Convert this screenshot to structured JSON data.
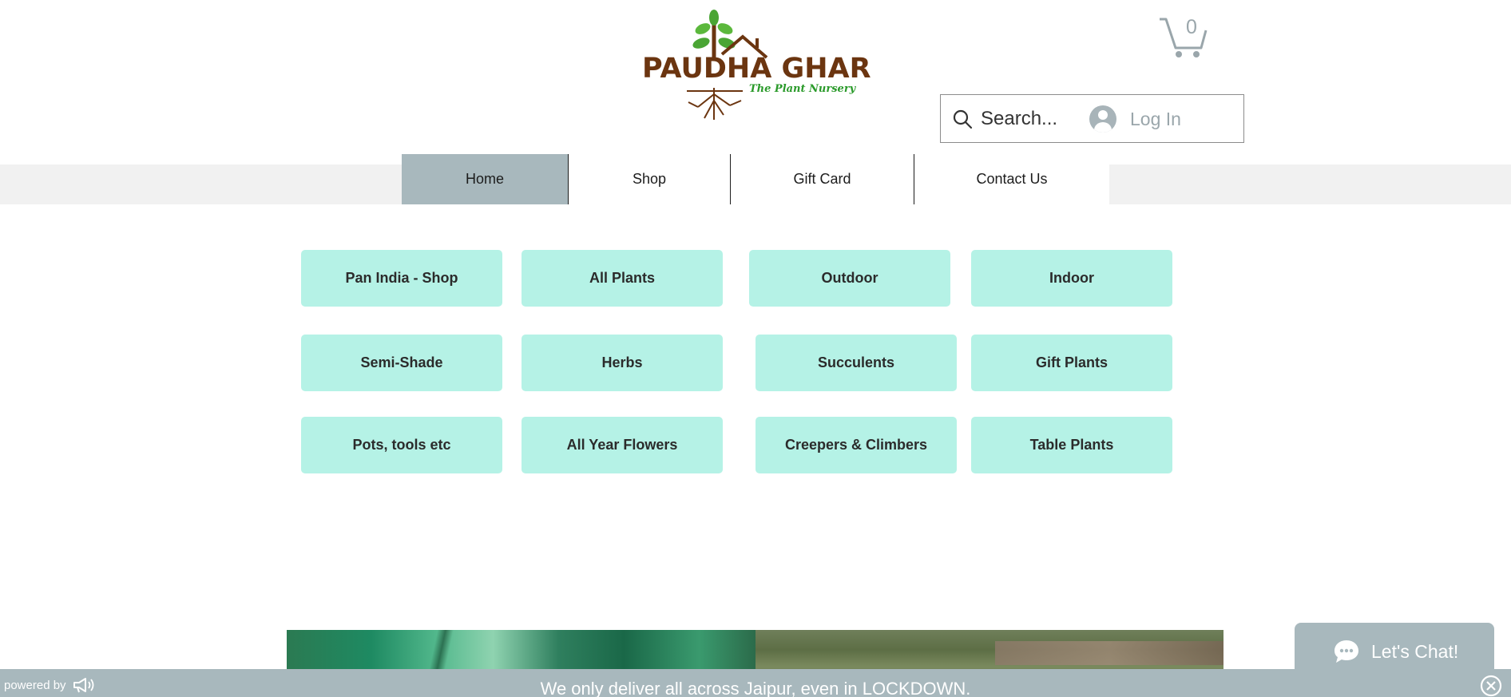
{
  "logo": {
    "brand": "PAUDHA GHAR",
    "tagline": "The Plant Nursery"
  },
  "cart": {
    "count": "0"
  },
  "search": {
    "placeholder": "Search..."
  },
  "login": {
    "label": "Log In"
  },
  "nav": {
    "items": [
      "Home",
      "Shop",
      "Gift Card",
      "Contact Us"
    ],
    "active": "Home"
  },
  "categories": [
    "Pan India - Shop",
    "All Plants",
    "Outdoor",
    "Indoor",
    "Semi-Shade",
    "Herbs",
    "Succulents",
    "Gift Plants",
    "Pots, tools etc",
    "All Year Flowers",
    "Creepers & Climbers",
    "Table Plants"
  ],
  "chat": {
    "label": "Let's Chat!"
  },
  "bottom_bar": {
    "powered_by": "powered by",
    "announcement": "We only deliver all across Jaipur, even in LOCKDOWN."
  },
  "colors": {
    "accent": "#a8b8bd",
    "category_button": "#b5f2e6",
    "brand_brown": "#6b3510",
    "brand_green": "#2a9a2a"
  },
  "icons": [
    "leaf-tree-icon",
    "cart-icon",
    "search-icon",
    "avatar-icon",
    "chat-bubble-icon",
    "megaphone-icon",
    "close-icon"
  ]
}
